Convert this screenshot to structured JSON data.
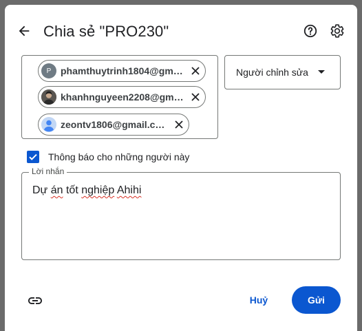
{
  "dialog": {
    "title": "Chia sẻ \"PRO230\""
  },
  "recipients": [
    {
      "email": "phamthuytrinh1804@gmai…",
      "avatar_letter": "P",
      "avatar_color": "#6f7b84",
      "avatar_kind": "letter"
    },
    {
      "email": "khanhnguyeen2208@gmai…",
      "avatar_kind": "photo"
    },
    {
      "email": "zeontv1806@gmail.com",
      "avatar_kind": "default-person"
    }
  ],
  "role": {
    "selected": "Người chỉnh sửa"
  },
  "notify": {
    "label": "Thông báo cho những người này",
    "checked": true
  },
  "message": {
    "legend": "Lời nhắn",
    "words": [
      "Dự",
      "án",
      "tốt",
      "nghiệp",
      "Ahihi"
    ]
  },
  "footer": {
    "cancel_label": "Huỷ",
    "send_label": "Gửi"
  },
  "colors": {
    "accent": "#0b57d0",
    "border": "#747775",
    "text": "#202124",
    "overlay": "#6b6b6b"
  },
  "icons": [
    "arrow-back-icon",
    "help-icon",
    "gear-icon",
    "close-icon",
    "link-icon",
    "checkmark-icon",
    "dropdown-caret-icon",
    "person-icon"
  ]
}
